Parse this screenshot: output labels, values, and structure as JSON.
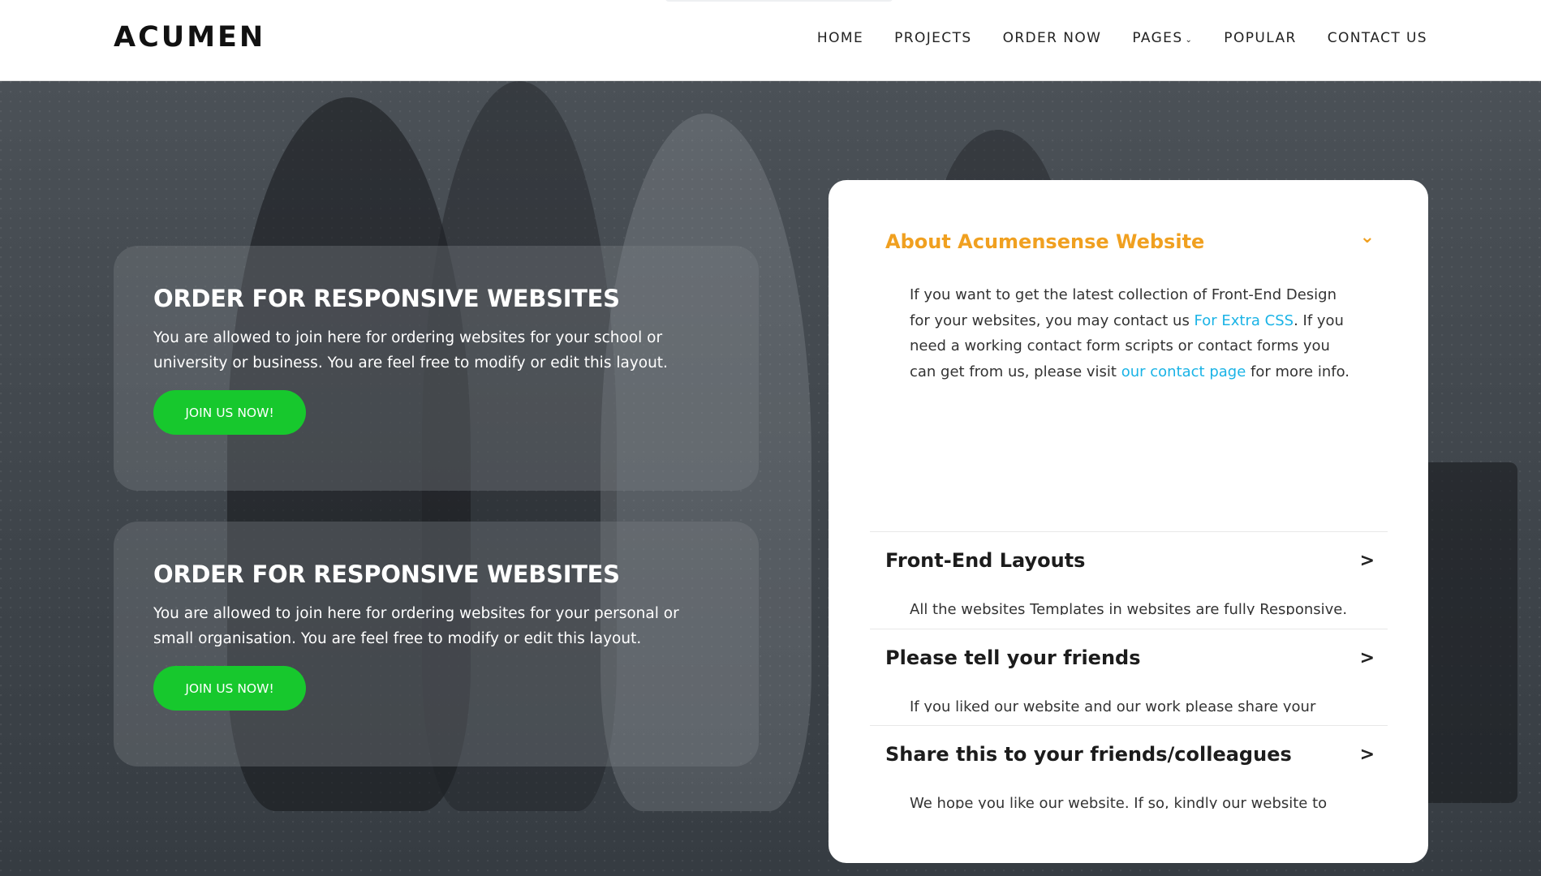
{
  "header": {
    "logo": "ACUMEN",
    "nav": [
      {
        "label": "HOME"
      },
      {
        "label": "PROJECTS"
      },
      {
        "label": "ORDER NOW"
      },
      {
        "label": "PAGES",
        "caret": "chevron-down-icon"
      },
      {
        "label": "POPULAR"
      },
      {
        "label": "CONTACT US"
      }
    ]
  },
  "hero": {
    "cards": [
      {
        "title": "ORDER FOR RESPONSIVE WEBSITES",
        "text": "You are allowed to join here for ordering websites for your school or university or business. You are feel free to modify or edit this layout.",
        "button": "JOIN US NOW!"
      },
      {
        "title": "ORDER FOR RESPONSIVE WEBSITES",
        "text": "You are allowed to join here for ordering websites for your personal or small organisation. You are feel free to modify or edit this layout.",
        "button": "JOIN US NOW!"
      }
    ]
  },
  "accordion": {
    "items": [
      {
        "title": "About Acumensense Website",
        "open": true,
        "icon": "chevron-down-icon",
        "body_parts": {
          "p1": "If you want to get the latest collection of Front-End Design for your websites, you may contact us ",
          "link1": "For Extra CSS",
          "p2": ". If you need a working contact form scripts or contact forms you can get from us, please visit ",
          "link2": "our contact page",
          "p3": " for more info."
        }
      },
      {
        "title": "Front-End Layouts",
        "open": false,
        "icon": "chevron-right-icon",
        "body": "All the websites Templates in websites are fully Responsive."
      },
      {
        "title": "Please tell your friends",
        "open": false,
        "icon": "chevron-right-icon",
        "body": "If you liked our website and our work please share your"
      },
      {
        "title": "Share this to your friends/colleagues",
        "open": false,
        "icon": "chevron-right-icon",
        "body": "We hope you like our website. If so, kindly our website to your"
      }
    ]
  },
  "colors": {
    "accent": "#f0a020",
    "button": "#17c82d",
    "link": "#1ab3e6"
  }
}
